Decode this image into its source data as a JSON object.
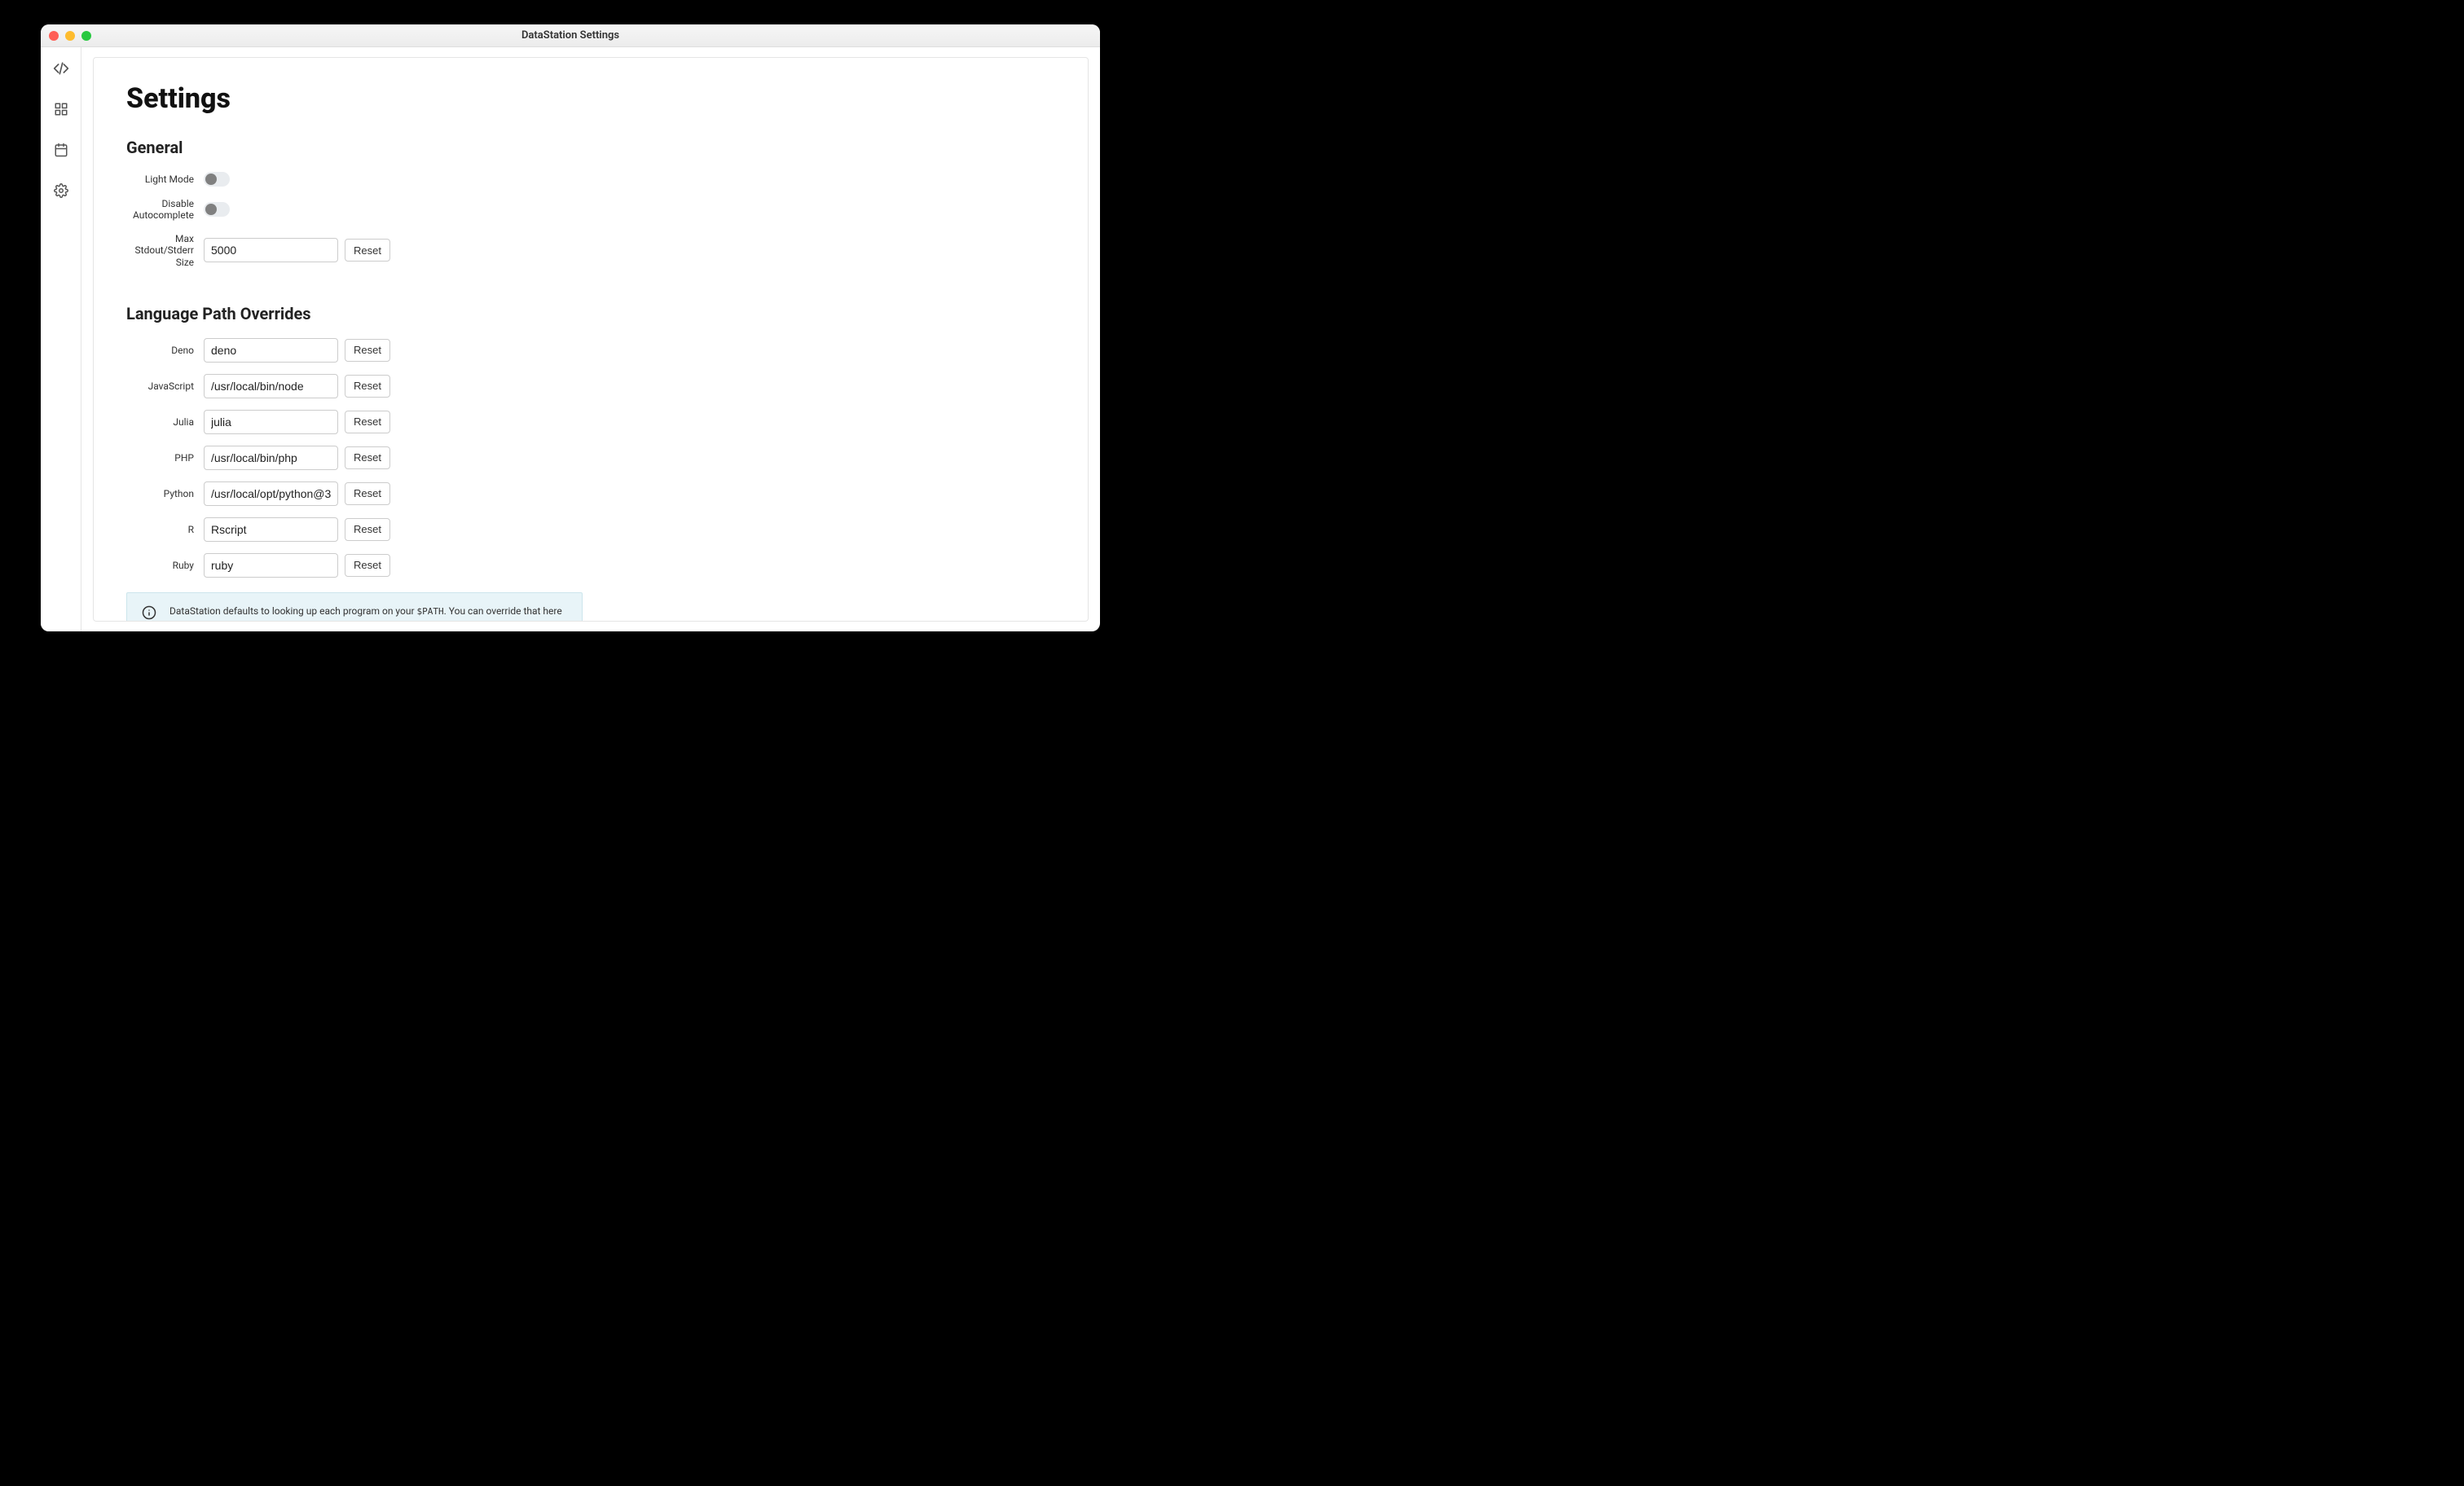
{
  "window": {
    "title": "DataStation Settings"
  },
  "page": {
    "title": "Settings"
  },
  "sections": {
    "general": {
      "title": "General",
      "light_mode_label": "Light Mode",
      "disable_autocomplete_label": "Disable Autocomplete",
      "max_stdout_label": "Max Stdout/Stderr Size",
      "max_stdout_value": "5000",
      "reset_label": "Reset"
    },
    "language_paths": {
      "title": "Language Path Overrides",
      "reset_label": "Reset",
      "rows": [
        {
          "label": "Deno",
          "value": "deno"
        },
        {
          "label": "JavaScript",
          "value": "/usr/local/bin/node"
        },
        {
          "label": "Julia",
          "value": "julia"
        },
        {
          "label": "PHP",
          "value": "/usr/local/bin/php"
        },
        {
          "label": "Python",
          "value": "/usr/local/opt/python@3"
        },
        {
          "label": "R",
          "value": "Rscript"
        },
        {
          "label": "Ruby",
          "value": "ruby"
        }
      ],
      "info_prefix": "DataStation defaults to looking up each program on your ",
      "info_code": "$PATH",
      "info_suffix": ". You can override that here with a different program name or an absolute path."
    }
  }
}
